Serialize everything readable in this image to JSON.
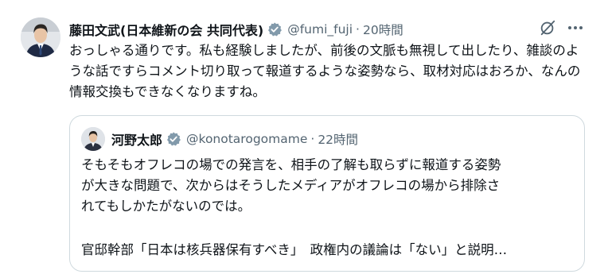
{
  "tweet": {
    "author": {
      "display_name": "藤田文武(日本維新の会 共同代表)",
      "handle": "@fumi_fuji",
      "dot": "·",
      "time": "20時間"
    },
    "body": "おっしゃる通りです。私も経験しましたが、前後の文脈も無視して出したり、雑談のような話ですらコメント切り取って報道するような姿勢なら、取材対応はおろか、なんの情報交換もできなくなりますね。",
    "icons": {
      "verified": "verified-badge-icon",
      "grok": "grok-icon",
      "more": "more-icon"
    },
    "colors": {
      "verified_fill": "#829aab",
      "secondary_text": "#536471",
      "border": "#cfd9de"
    }
  },
  "quote": {
    "author": {
      "display_name": "河野太郎",
      "handle": "@konotarogomame",
      "dot": "·",
      "time": "22時間"
    },
    "lines": [
      "そもそもオフレコの場での発言を、相手の了解も取らずに報道する姿勢",
      "が大きな問題で、次からはそうしたメディアがオフレコの場から排除さ",
      "れてもしかたがないのでは。"
    ],
    "link_line": "官邸幹部「日本は核兵器保有すべき」　政権内の議論は「ない」と説明…"
  }
}
